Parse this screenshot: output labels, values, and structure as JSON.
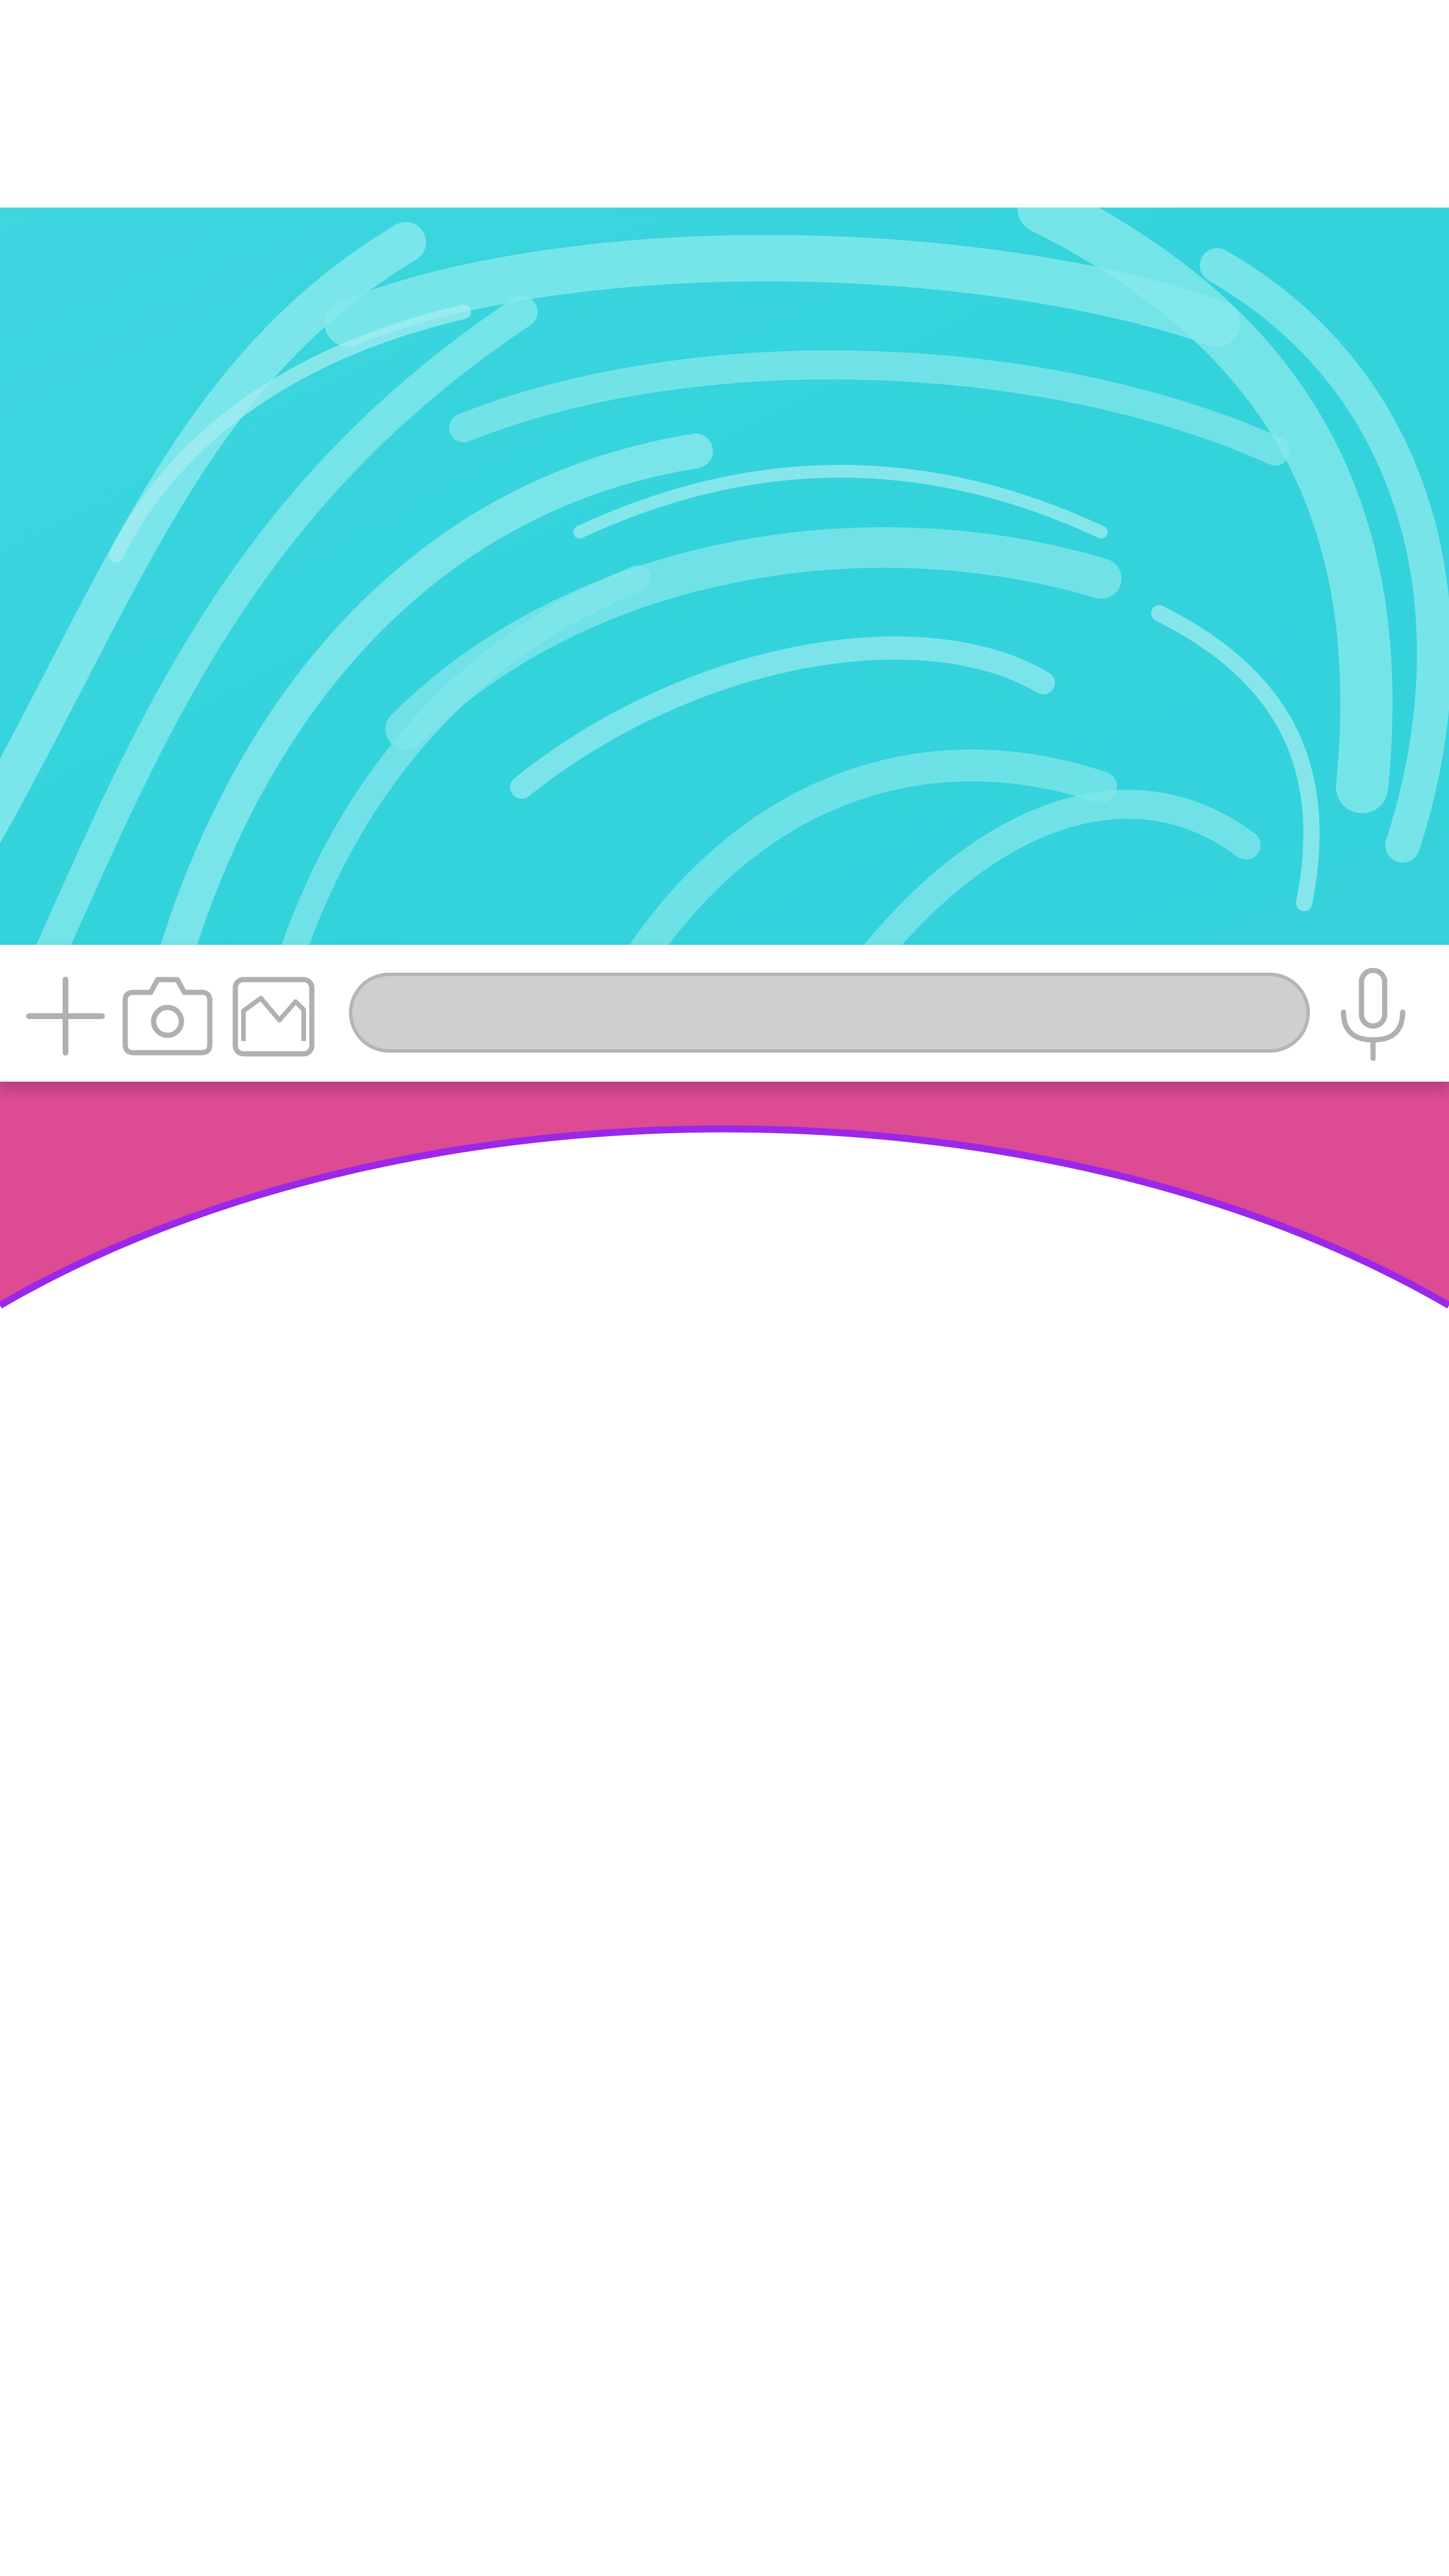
{
  "input_bar": {
    "message_field": {
      "value": "",
      "placeholder": ""
    },
    "icons": {
      "add": "plus-icon",
      "camera": "camera-icon",
      "gallery": "image-icon",
      "voice": "microphone-icon"
    }
  },
  "colors": {
    "hero_base": "#33d3dc",
    "hero_light": "#7fe6ea",
    "arch_fill": "#dc4b93",
    "arch_border": "#9b27e8",
    "icon_gray": "#b0b0b0",
    "field_fill": "#cfcfcf"
  }
}
